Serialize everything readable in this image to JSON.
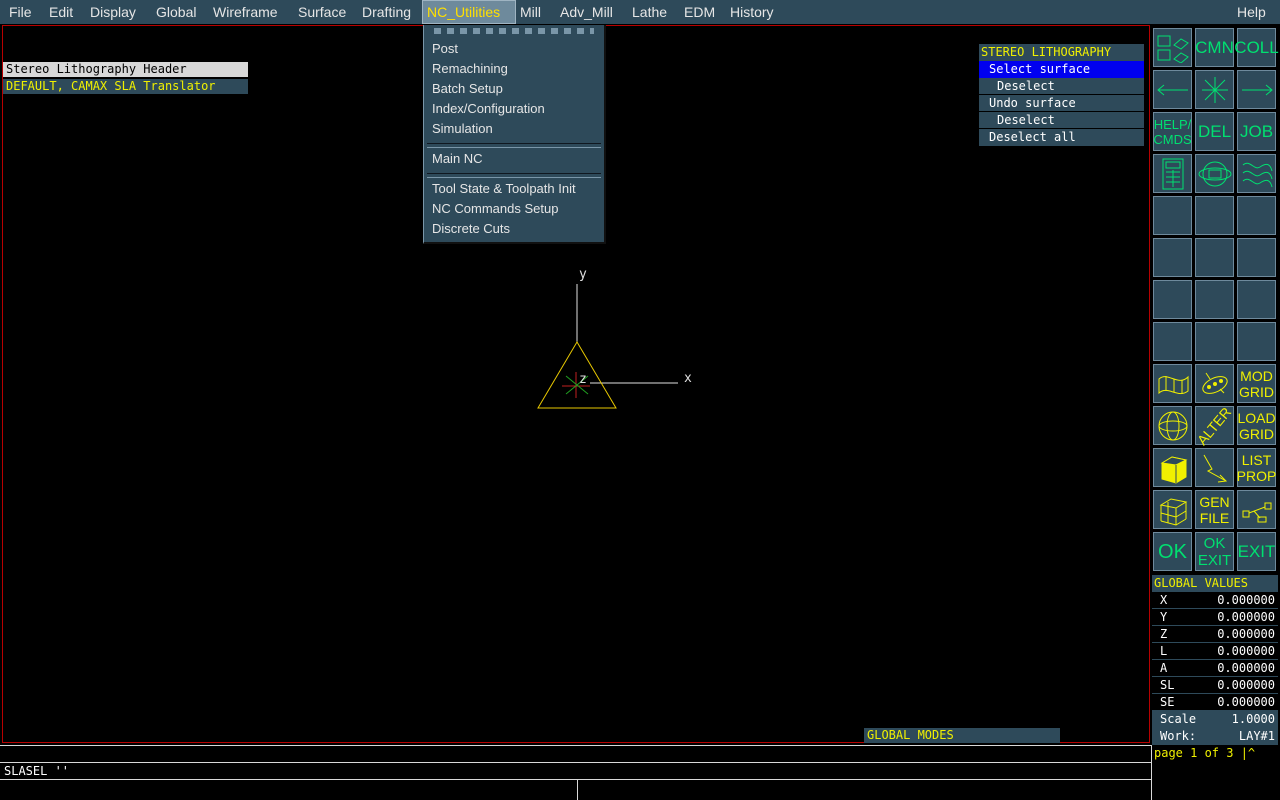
{
  "menubar": {
    "items": [
      "File",
      "Edit",
      "Display",
      "Global",
      "Wireframe",
      "Surface",
      "Drafting",
      "NC_Utilities",
      "Mill",
      "Adv_Mill",
      "Lathe",
      "EDM",
      "History"
    ],
    "help": "Help"
  },
  "dropdown": {
    "group1": [
      "Post",
      "Remachining",
      "Batch Setup",
      "Index/Configuration",
      "Simulation"
    ],
    "group2": [
      "Main NC"
    ],
    "group3": [
      "Tool State & Toolpath Init",
      "NC Commands Setup",
      "Discrete Cuts"
    ]
  },
  "sla": {
    "header": "Stereo Lithography Header",
    "translator": "DEFAULT, CAMAX SLA Translator"
  },
  "stereo_panel": {
    "title": "STEREO LITHOGRAPHY",
    "items": [
      "Select surface",
      "Deselect",
      "Undo surface",
      "Deselect",
      "Deselect all"
    ]
  },
  "axes": {
    "x": "x",
    "y": "y",
    "z": "z"
  },
  "icons": {
    "cmn": "CMN",
    "coll": "COLL",
    "help_cmds_1": "HELP/",
    "help_cmds_2": "CMDS",
    "del": "DEL",
    "job": "JOB",
    "mod_grid_1": "MOD",
    "mod_grid_2": "GRID",
    "alter": "ALTER",
    "load_grid_1": "LOAD",
    "load_grid_2": "GRID",
    "list_prop_1": "LIST",
    "list_prop_2": "PROP",
    "gen_file_1": "GEN",
    "gen_file_2": "FILE",
    "ok": "OK",
    "ok_exit_1": "OK",
    "ok_exit_2": "EXIT",
    "exit": "EXIT"
  },
  "global_values": {
    "title": "GLOBAL VALUES",
    "rows": [
      {
        "label": "X",
        "value": "0.000000"
      },
      {
        "label": "Y",
        "value": "0.000000"
      },
      {
        "label": "Z",
        "value": "0.000000"
      },
      {
        "label": "L",
        "value": "0.000000"
      },
      {
        "label": "A",
        "value": "0.000000"
      },
      {
        "label": "SL",
        "value": "0.000000"
      },
      {
        "label": "SE",
        "value": "0.000000"
      }
    ],
    "scale_label": "Scale",
    "scale_value": "1.0000",
    "work_label": "Work:",
    "work_value": "LAY#1",
    "page": "page 1 of 3 |^"
  },
  "global_modes": "GLOBAL MODES",
  "command_line": "SLASEL ''",
  "colors": {
    "menu_bg": "#2e4a5a",
    "select_bg": "#0000ff",
    "accent_yellow": "#f0f000",
    "icon_green": "#00e070"
  }
}
